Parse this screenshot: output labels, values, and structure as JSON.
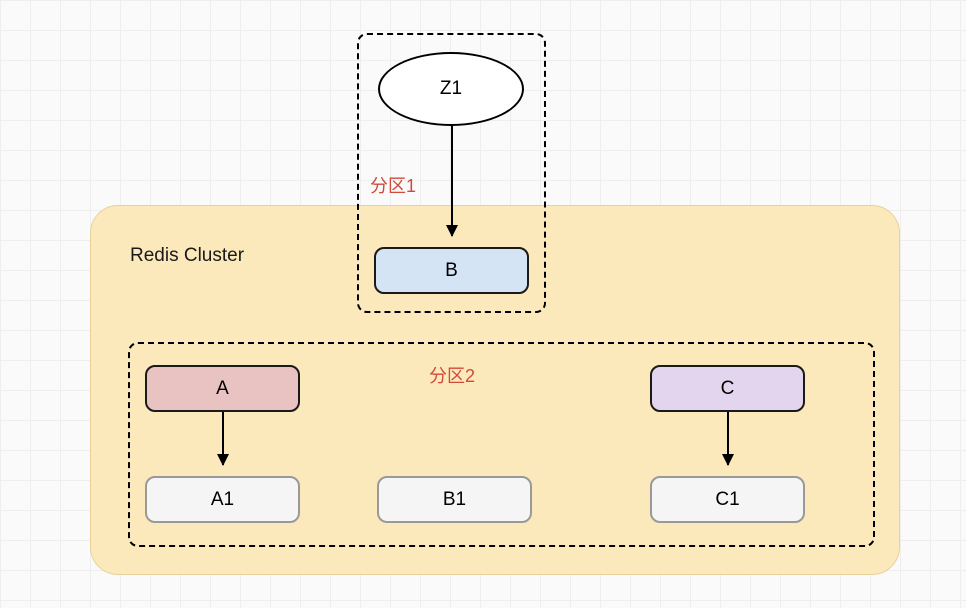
{
  "cluster": {
    "label": "Redis Cluster"
  },
  "partition1": {
    "label": "分区1"
  },
  "partition2": {
    "label": "分区2"
  },
  "nodes": {
    "z1": "Z1",
    "b": "B",
    "a": "A",
    "c": "C",
    "a1": "A1",
    "b1": "B1",
    "c1": "C1"
  }
}
